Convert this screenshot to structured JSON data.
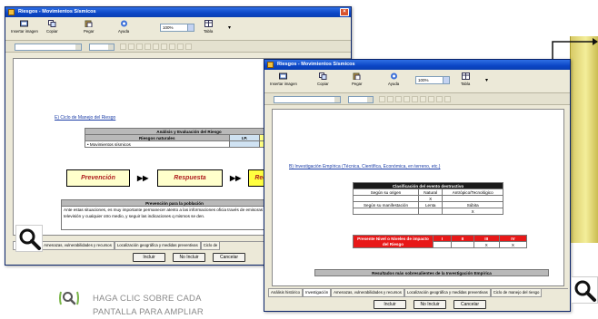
{
  "window_title": "Riesgos - Movimientos Sísmicos",
  "toolbar": {
    "insert_image": "Insertar imagen",
    "copy": "Copiar",
    "paste": "Pegar",
    "listen": "Ayuda",
    "zoom": "100%",
    "table": "Tabla"
  },
  "left_doc": {
    "section_link": "E) Ciclo de Manejo del Riesgo",
    "analysis_title": "Análisis y Evaluación del Riesgo",
    "col_natural": "Riesgos naturales",
    "col_ip": "I.P.",
    "col_id": "I.D.",
    "row_item": "Movimientos sísmicos",
    "flow": [
      "Prevención",
      "Respuesta",
      "Recupe"
    ],
    "prevention_title": "Prevención para la población",
    "prevention_text": "Ante estas situaciones, es muy importante permanecer atento a las informaciones oficia través de emisoras de radio, televisión y cualquier otro medio, y seguir las indicaciones q mismos se den."
  },
  "left_tabs": [
    "Investigación",
    "Amenazas, vulnerabilidades y recursos",
    "Localización geográfica y medidas preventivas",
    "Ciclo de"
  ],
  "right_doc": {
    "section_link": "B) Investigación Empírica (Técnica, Científica, Económica, en terreno, etc.)",
    "classif_title": "Clasificación del evento destructivo",
    "row1_label": "Según su origen",
    "row1_natural": "Natural",
    "row1_anthropic": "Antrópico/Tecnológico",
    "row1_mark": "X",
    "row2_label": "Según su manifestación",
    "row2_slow": "Lenta",
    "row2_sudden": "Súbita",
    "row2_mark": "X",
    "risk_label": "Presente Nivel o Niveles de impacto del Riesgo",
    "levels": [
      "I",
      "II",
      "III",
      "IV"
    ],
    "level_marks": [
      "",
      "",
      "X",
      "X"
    ],
    "results_title": "Resultados más sobresalientes de la Investigación Empírica"
  },
  "right_tabs": [
    "Análisis histórico",
    "Investigación",
    "Amenazas, vulnerabilidades y recursos",
    "Localización geográfica y medidas preventivas",
    "Ciclo de manejo del riesgo"
  ],
  "buttons": {
    "include": "Incluir",
    "not_include": "No Incluir",
    "cancel": "Cancelar"
  },
  "hint": {
    "line1": "HAGA CLIC SOBRE CADA",
    "line2": "PANTALLA PARA AMPLIAR"
  },
  "icons": {
    "magnifier": "magnifier-icon",
    "hint": "magnifier-hint-icon"
  }
}
